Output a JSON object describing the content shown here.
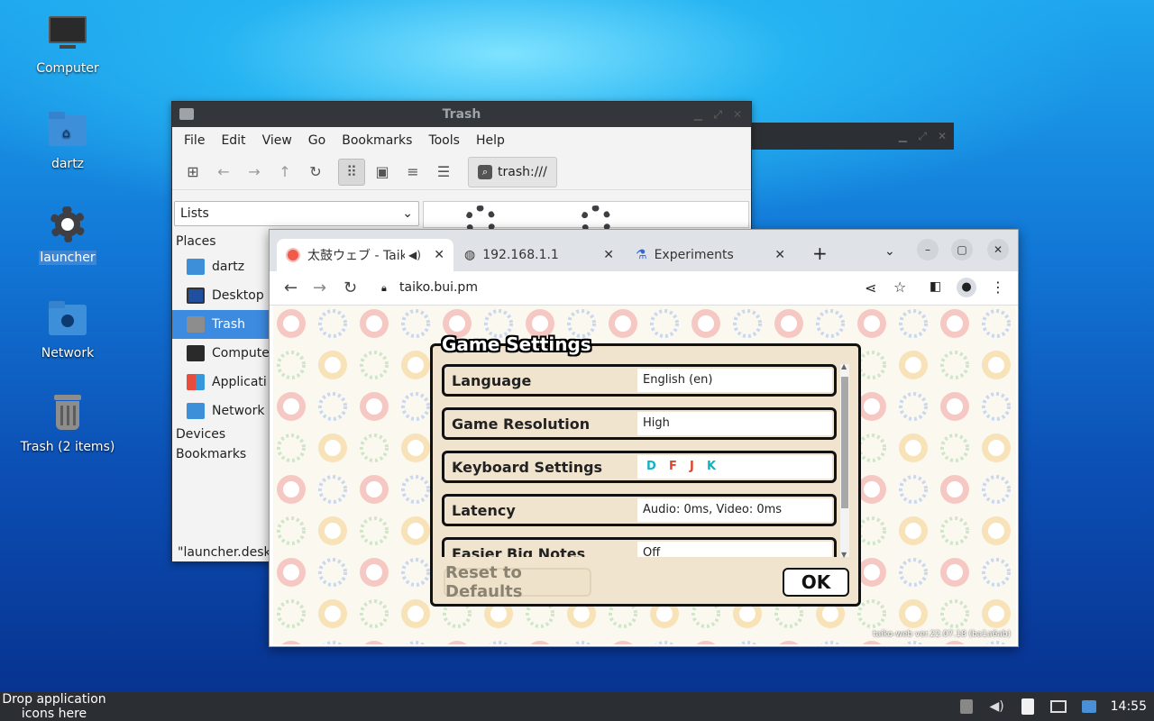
{
  "desktop": {
    "icons": [
      {
        "label": "Computer",
        "icon": "computer-icon"
      },
      {
        "label": "dartz",
        "icon": "home-folder-icon"
      },
      {
        "label": "launcher",
        "icon": "gear-icon"
      },
      {
        "label": "Network",
        "icon": "network-folder-icon"
      },
      {
        "label": "Trash (2 items)",
        "icon": "trash-icon"
      }
    ]
  },
  "thunar": {
    "title": "Trash",
    "menu": [
      "File",
      "Edit",
      "View",
      "Go",
      "Bookmarks",
      "Tools",
      "Help"
    ],
    "location": "trash:///",
    "view_selector": "Lists",
    "places_header": "Places",
    "places": [
      "dartz",
      "Desktop",
      "Trash",
      "Compute",
      "Applicati",
      "Network"
    ],
    "devices_header": "Devices",
    "bookmarks_header": "Bookmarks",
    "status": "\"launcher.desk"
  },
  "browser": {
    "tabs": [
      {
        "label": "太鼓ウェブ - Taik"
      },
      {
        "label": "192.168.1.1"
      },
      {
        "label": "Experiments"
      }
    ],
    "url": "taiko.bui.pm",
    "version": "taiko-web ver.22.07.18 (ba1a6ab)"
  },
  "game_settings": {
    "title": "Game Settings",
    "rows": [
      {
        "label": "Language",
        "value": "English (en)"
      },
      {
        "label": "Game Resolution",
        "value": "High"
      },
      {
        "label": "Keyboard Settings",
        "keys": [
          "D",
          "F",
          "J",
          "K"
        ],
        "key_colors": [
          "#0fb3c4",
          "#e0432b",
          "#e0432b",
          "#0fb3c4"
        ]
      },
      {
        "label": "Latency",
        "value": "Audio: 0ms, Video: 0ms"
      },
      {
        "label": "Easier Big Notes",
        "value": "Off"
      }
    ],
    "reset_label": "Reset to Defaults",
    "ok_label": "OK"
  },
  "taskbar": {
    "drop_text": "Drop application icons here",
    "clock": "14:55"
  }
}
